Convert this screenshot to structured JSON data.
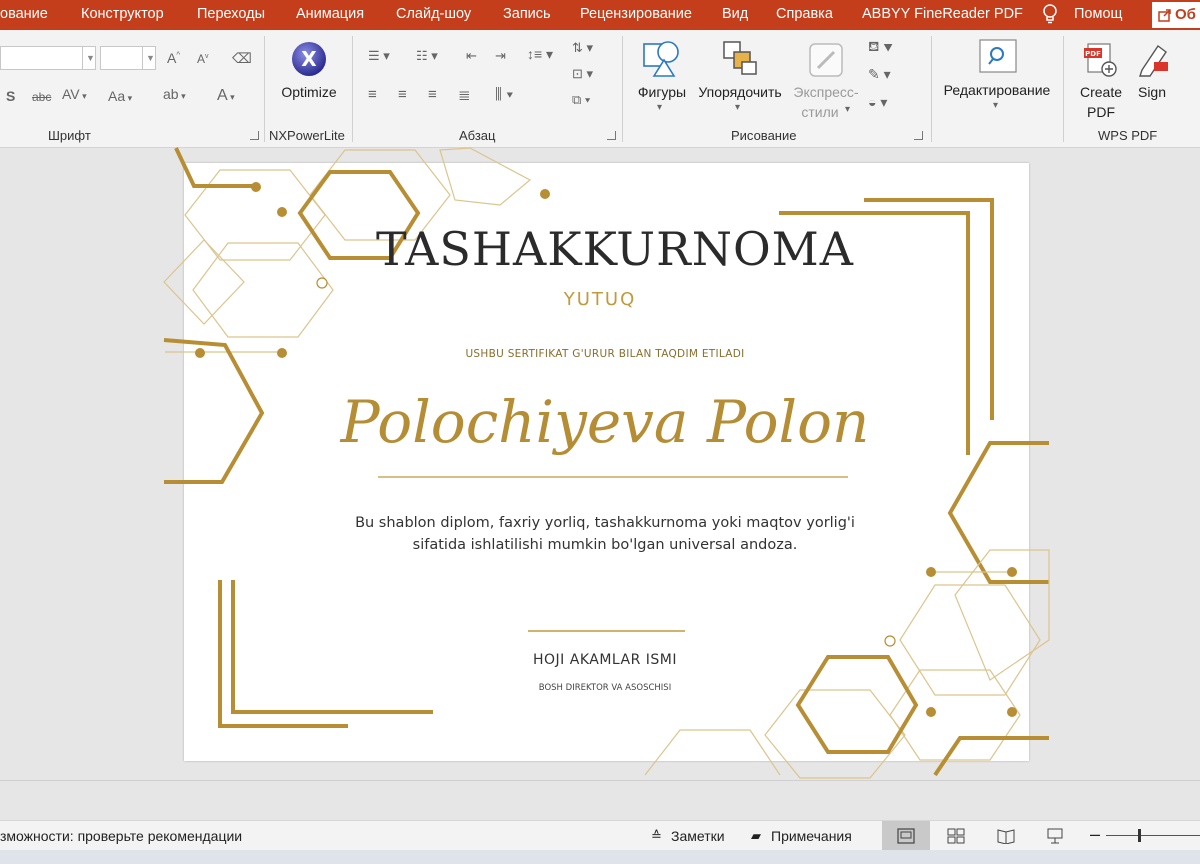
{
  "menu": {
    "items": [
      "ование",
      "Конструктор",
      "Переходы",
      "Анимация",
      "Слайд-шоу",
      "Запись",
      "Рецензирование",
      "Вид",
      "Справка",
      "ABBYY FineReader PDF"
    ],
    "help_search": "Помощ",
    "share_label": "Об"
  },
  "ribbon": {
    "groups": {
      "font": "Шрифт",
      "nxpowerlite": "NXPowerLite",
      "paragraph": "Абзац",
      "drawing": "Рисование",
      "wps": "WPS PDF"
    },
    "buttons": {
      "optimize": "Optimize",
      "shapes": "Фигуры",
      "arrange": "Упорядочить",
      "quick_styles_1": "Экспресс-",
      "quick_styles_2": "стили",
      "editing": "Редактирование",
      "create_pdf_1": "Create",
      "create_pdf_2": "PDF",
      "sign": "Sign"
    }
  },
  "slide": {
    "title": "TASHAKKURNOMA",
    "subtitle": "YUTUQ",
    "presented": "USHBU SERTIFIKAT G'URUR BILAN TAQDIM ETILADI",
    "recipient": "Polochiyeva Polon",
    "body_line1": "Bu shablon diplom, faxriy yorliq, tashakkurnoma yoki maqtov yorlig'i",
    "body_line2": "sifatida ishlatilishi mumkin bo'lgan universal andoza.",
    "signer": "HOJI AKAMLAR ISMI",
    "signer_role": "BOSH DIREKTOR VA ASOSCHISI"
  },
  "status": {
    "accessibility": "зможности: проверьте рекомендации",
    "notes": "Заметки",
    "comments": "Примечания"
  },
  "colors": {
    "accent": "#c43e1c",
    "gold": "#c09a3c",
    "gold_light": "#dcc48e"
  }
}
